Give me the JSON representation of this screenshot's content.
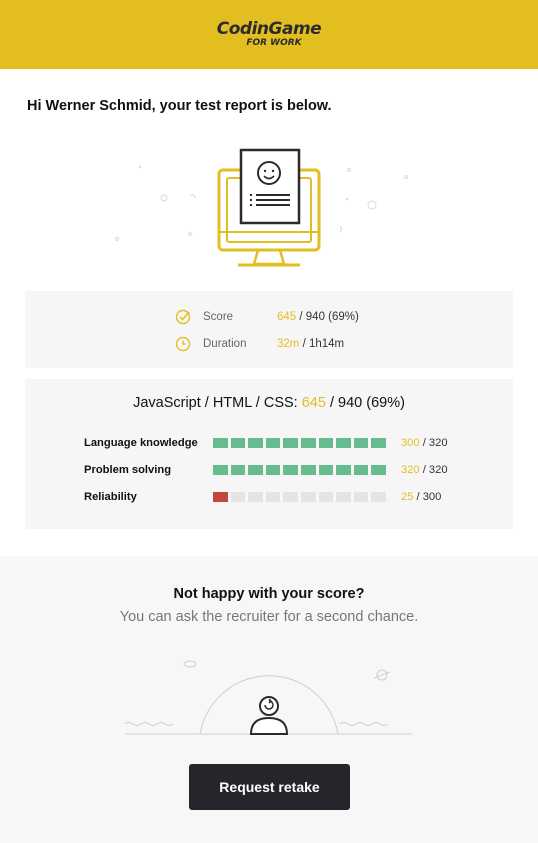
{
  "header": {
    "brand": "CodinGame",
    "sub": "FOR WORK"
  },
  "greeting": "Hi Werner Schmid, your test report is below.",
  "colors": {
    "accent": "#e3be21",
    "good": "#66bb8f",
    "bad": "#c4473d",
    "empty": "#e4e4e4"
  },
  "summary": {
    "score": {
      "icon": "check-circle-icon",
      "label": "Score",
      "value": "645",
      "rest": " / 940 (69%)"
    },
    "duration": {
      "icon": "clock-icon",
      "label": "Duration",
      "value": "32m",
      "rest": " / 1h14m"
    }
  },
  "skills": {
    "title_prefix": "JavaScript / HTML / CSS:",
    "score": "645",
    "rest": " / 940 (69%)",
    "rows": [
      {
        "label": "Language knowledge",
        "value": "300",
        "max": " / 320",
        "filled": 10,
        "total": 10,
        "type": "g"
      },
      {
        "label": "Problem solving",
        "value": "320",
        "max": " / 320",
        "filled": 10,
        "total": 10,
        "type": "g"
      },
      {
        "label": "Reliability",
        "value": "25",
        "max": " / 300",
        "filled": 1,
        "total": 10,
        "type": "r"
      }
    ]
  },
  "retake": {
    "question": "Not happy with your score?",
    "sub": "You can ask the recruiter for a second chance.",
    "button": "Request retake"
  }
}
